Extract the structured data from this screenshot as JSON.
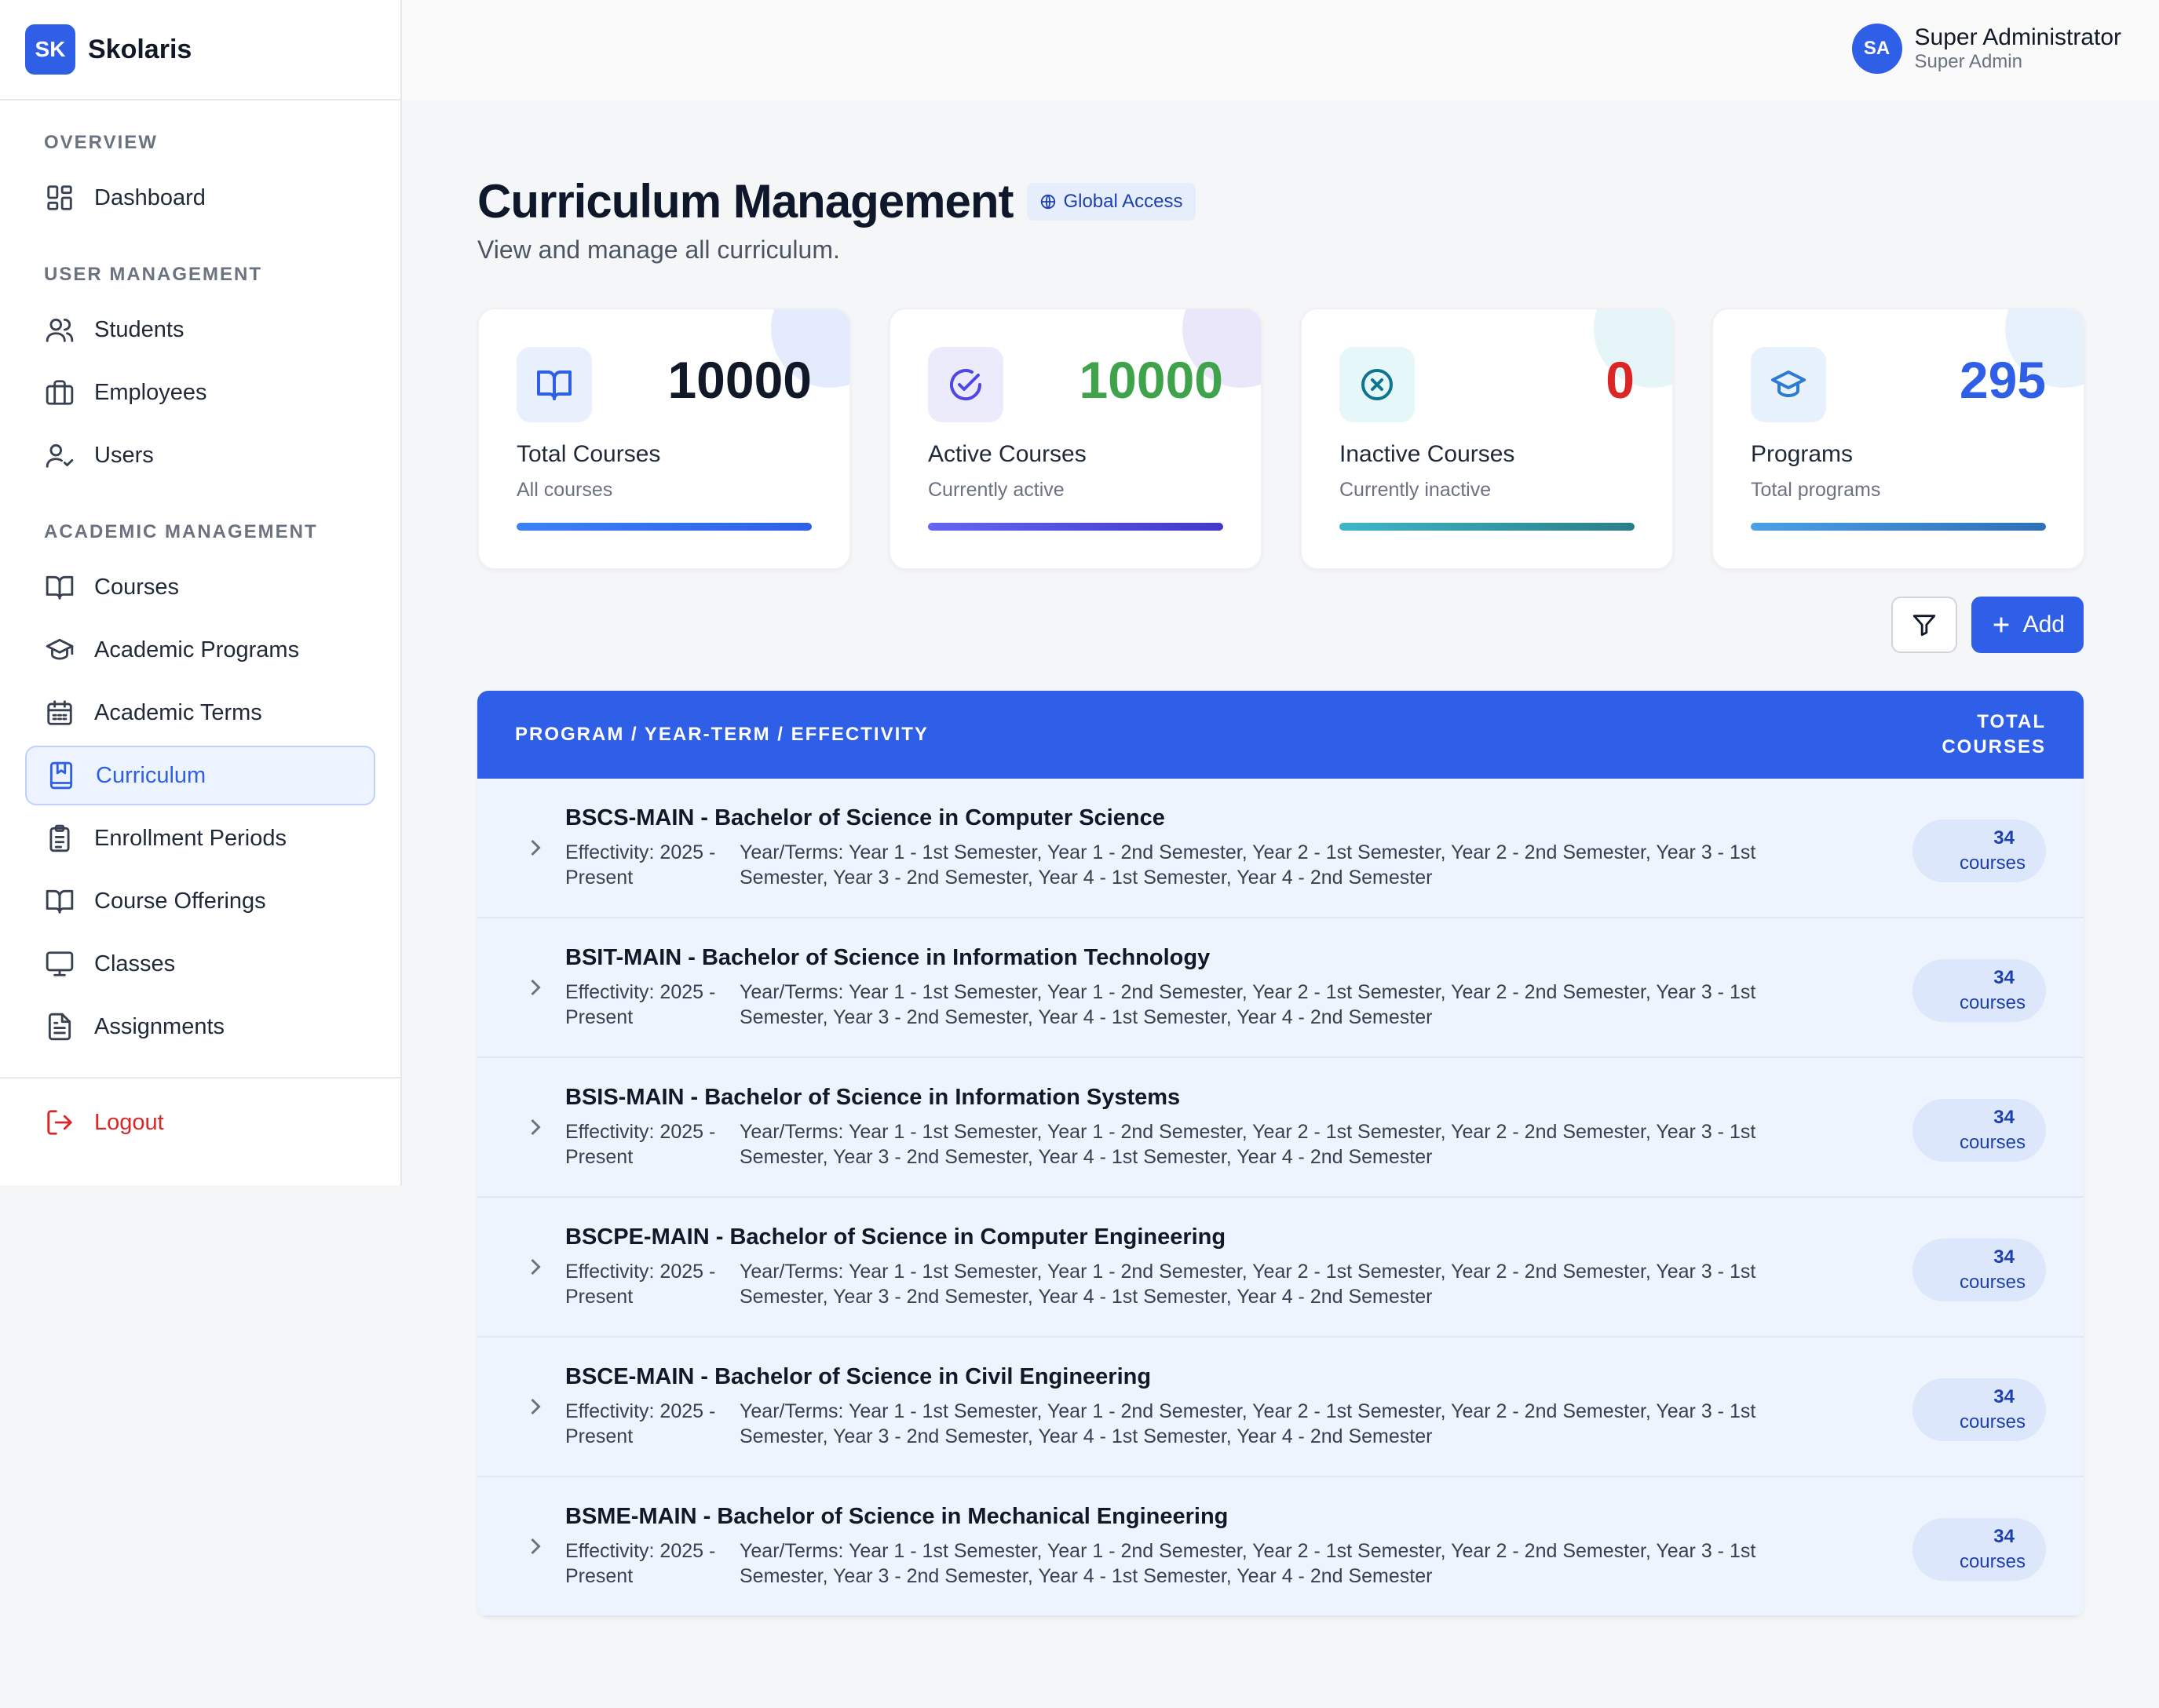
{
  "app": {
    "logo": "SK",
    "name": "Skolaris"
  },
  "user": {
    "initials": "SA",
    "name": "Super Administrator",
    "role": "Super Admin"
  },
  "sidebar": {
    "sections": [
      {
        "title": "OVERVIEW",
        "items": [
          {
            "label": "Dashboard",
            "icon": "dashboard-icon"
          }
        ]
      },
      {
        "title": "USER MANAGEMENT",
        "items": [
          {
            "label": "Students",
            "icon": "users-icon"
          },
          {
            "label": "Employees",
            "icon": "briefcase-icon"
          },
          {
            "label": "Users",
            "icon": "user-check-icon"
          }
        ]
      },
      {
        "title": "ACADEMIC MANAGEMENT",
        "items": [
          {
            "label": "Courses",
            "icon": "book-icon"
          },
          {
            "label": "Academic Programs",
            "icon": "graduation-cap-icon"
          },
          {
            "label": "Academic Terms",
            "icon": "calendar-icon"
          },
          {
            "label": "Curriculum",
            "icon": "book-bookmark-icon",
            "active": true
          },
          {
            "label": "Enrollment Periods",
            "icon": "clipboard-icon"
          },
          {
            "label": "Course Offerings",
            "icon": "book-open-icon"
          },
          {
            "label": "Classes",
            "icon": "monitor-icon"
          },
          {
            "label": "Assignments",
            "icon": "file-text-icon"
          }
        ]
      }
    ],
    "logout": "Logout"
  },
  "page": {
    "title": "Curriculum Management",
    "badge": "Global Access",
    "subtitle": "View and manage all curriculum."
  },
  "stats": [
    {
      "value": "10000",
      "label": "Total Courses",
      "sub": "All courses",
      "color": "#111827",
      "icon": "book-icon"
    },
    {
      "value": "10000",
      "label": "Active Courses",
      "sub": "Currently active",
      "color": "#3ea34a",
      "icon": "check-circle-icon"
    },
    {
      "value": "0",
      "label": "Inactive Courses",
      "sub": "Currently inactive",
      "color": "#dc2626",
      "icon": "x-circle-icon"
    },
    {
      "value": "295",
      "label": "Programs",
      "sub": "Total programs",
      "color": "#2f5fe6",
      "icon": "graduation-cap-icon"
    }
  ],
  "toolbar": {
    "filter_icon": "filter-icon",
    "add_label": "Add"
  },
  "table": {
    "col1": "PROGRAM / YEAR-TERM / EFFECTIVITY",
    "col2": "TOTAL COURSES",
    "rows": [
      {
        "title": "BSCS-MAIN - Bachelor of Science in Computer Science",
        "effectivity": "Effectivity: 2025 - Present",
        "terms_label": "Year/Terms:",
        "terms": "Year 1 - 1st Semester, Year 1 - 2nd Semester, Year 2 - 1st Semester, Year 2 - 2nd Semester, Year 3 - 1st Semester, Year 3 - 2nd Semester, Year 4 - 1st Semester, Year 4 - 2nd Semester",
        "count": "34",
        "unit": "courses"
      },
      {
        "title": "BSIT-MAIN - Bachelor of Science in Information Technology",
        "effectivity": "Effectivity: 2025 - Present",
        "terms_label": "Year/Terms:",
        "terms": "Year 1 - 1st Semester, Year 1 - 2nd Semester, Year 2 - 1st Semester, Year 2 - 2nd Semester, Year 3 - 1st Semester, Year 3 - 2nd Semester, Year 4 - 1st Semester, Year 4 - 2nd Semester",
        "count": "34",
        "unit": "courses"
      },
      {
        "title": "BSIS-MAIN - Bachelor of Science in Information Systems",
        "effectivity": "Effectivity: 2025 - Present",
        "terms_label": "Year/Terms:",
        "terms": "Year 1 - 1st Semester, Year 1 - 2nd Semester, Year 2 - 1st Semester, Year 2 - 2nd Semester, Year 3 - 1st Semester, Year 3 - 2nd Semester, Year 4 - 1st Semester, Year 4 - 2nd Semester",
        "count": "34",
        "unit": "courses"
      },
      {
        "title": "BSCPE-MAIN - Bachelor of Science in Computer Engineering",
        "effectivity": "Effectivity: 2025 - Present",
        "terms_label": "Year/Terms:",
        "terms": "Year 1 - 1st Semester, Year 1 - 2nd Semester, Year 2 - 1st Semester, Year 2 - 2nd Semester, Year 3 - 1st Semester, Year 3 - 2nd Semester, Year 4 - 1st Semester, Year 4 - 2nd Semester",
        "count": "34",
        "unit": "courses"
      },
      {
        "title": "BSCE-MAIN - Bachelor of Science in Civil Engineering",
        "effectivity": "Effectivity: 2025 - Present",
        "terms_label": "Year/Terms:",
        "terms": "Year 1 - 1st Semester, Year 1 - 2nd Semester, Year 2 - 1st Semester, Year 2 - 2nd Semester, Year 3 - 1st Semester, Year 3 - 2nd Semester, Year 4 - 1st Semester, Year 4 - 2nd Semester",
        "count": "34",
        "unit": "courses"
      },
      {
        "title": "BSME-MAIN - Bachelor of Science in Mechanical Engineering",
        "effectivity": "Effectivity: 2025 - Present",
        "terms_label": "Year/Terms:",
        "terms": "Year 1 - 1st Semester, Year 1 - 2nd Semester, Year 2 - 1st Semester, Year 2 - 2nd Semester, Year 3 - 1st Semester, Year 3 - 2nd Semester, Year 4 - 1st Semester, Year 4 - 2nd Semester",
        "count": "34",
        "unit": "courses"
      }
    ]
  }
}
